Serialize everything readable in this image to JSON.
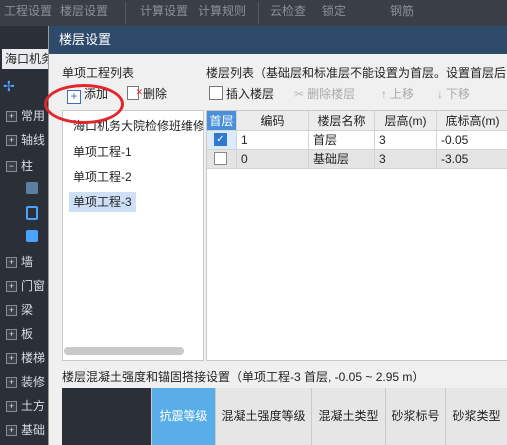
{
  "background_toolbar": {
    "items": [
      "工程设置",
      "楼层设置",
      "计算设置",
      "计算规则",
      "云检查",
      "锁定",
      "钢筋"
    ]
  },
  "project": {
    "name": "海口机务"
  },
  "sidebar": {
    "items": [
      {
        "label": "常用",
        "icon": "plus-box-icon"
      },
      {
        "label": "轴线",
        "icon": "plus-box-icon"
      },
      {
        "label": "柱",
        "icon": "minus-box-icon"
      },
      {
        "label": "墙",
        "icon": "plus-box-icon"
      },
      {
        "label": "门窗",
        "icon": "plus-box-icon"
      },
      {
        "label": "梁",
        "icon": "plus-box-icon"
      },
      {
        "label": "板",
        "icon": "plus-box-icon"
      },
      {
        "label": "楼梯",
        "icon": "plus-box-icon"
      },
      {
        "label": "装修",
        "icon": "plus-box-icon"
      },
      {
        "label": "土方",
        "icon": "plus-box-icon"
      },
      {
        "label": "基础",
        "icon": "plus-box-icon"
      }
    ]
  },
  "dialog": {
    "title": "楼层设置",
    "project_list_label": "单项工程列表",
    "add_label": "添加",
    "delete_label": "删除",
    "projects": [
      "海口机务大院检修班维修工程",
      "单项工程-1",
      "单项工程-2",
      "单项工程-3"
    ],
    "selected_project_index": 3,
    "floor_list_label": "楼层列表（基础层和标准层不能设置为首层。设置首层后",
    "toolbar": {
      "insert": "插入楼层",
      "delete": "删除楼层",
      "up": "上移",
      "down": "下移"
    },
    "grid": {
      "columns": [
        "首层",
        "编码",
        "楼层名称",
        "层高(m)",
        "底标高(m)"
      ],
      "rows": [
        {
          "first": true,
          "code": "1",
          "name": "首层",
          "height": "3",
          "bottom": "-0.05"
        },
        {
          "first": false,
          "code": "0",
          "name": "基础层",
          "height": "3",
          "bottom": "-3.05"
        }
      ]
    },
    "strength_label": "楼层混凝土强度和锚固搭接设置（单项工程-3  首层, -0.05 ~ 2.95 m）",
    "bottom_tabs": [
      "抗震等级",
      "混凝土强度等级",
      "混凝土类型",
      "砂浆标号",
      "砂浆类型"
    ],
    "active_tab": 0
  },
  "colors": {
    "accent": "#4a90d9",
    "annotation": "#e2262b",
    "title_bar": "#2e4a6b"
  }
}
